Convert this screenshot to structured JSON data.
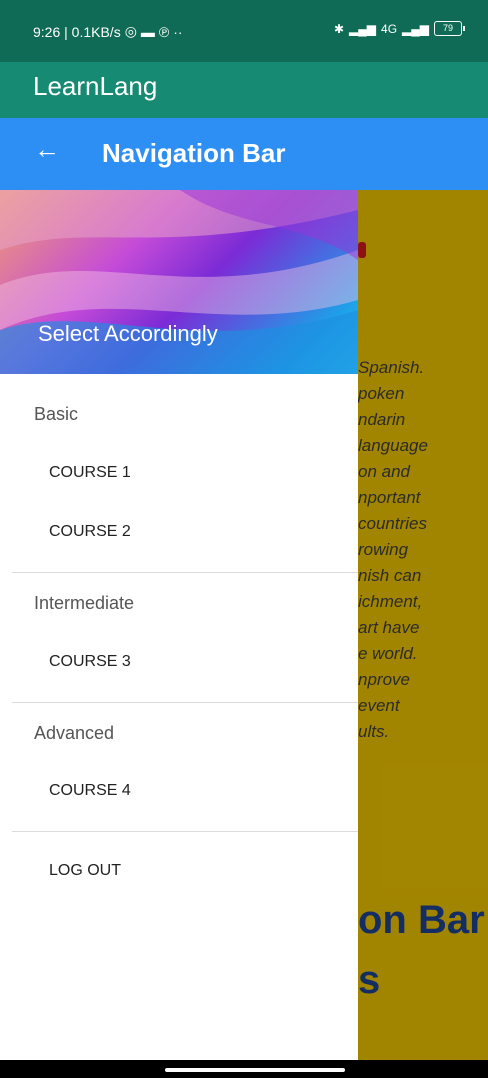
{
  "status_bar": {
    "time_speed": "9:26 | 0.1KB/s",
    "dots": "··",
    "network": "4G",
    "battery": "79"
  },
  "app_bar": {
    "title": "LearnLang"
  },
  "nav_bar": {
    "back_symbol": "←",
    "title": "Navigation Bar"
  },
  "drawer": {
    "header_text": "Select Accordingly",
    "sections": [
      {
        "label": "Basic",
        "items": [
          "COURSE 1",
          "COURSE 2"
        ]
      },
      {
        "label": "Intermediate",
        "items": [
          "COURSE 3"
        ]
      },
      {
        "label": "Advanced",
        "items": [
          "COURSE 4"
        ]
      }
    ],
    "logout_label": "LOG OUT"
  },
  "background": {
    "text_lines": [
      "Spanish.",
      "poken",
      "ndarin",
      "language",
      "on and",
      "nportant",
      "countries",
      "rowing",
      "nish can",
      "ichment,",
      "art have",
      "e world.",
      "nprove",
      "event",
      "ults."
    ],
    "heading_lines": [
      "on Bar",
      "s"
    ]
  },
  "colors": {
    "status_bar": "#0f6b56",
    "app_bar": "#168a73",
    "nav_bar": "#2d8ef3",
    "background_content": "#e0b800"
  },
  "icons": {
    "status": [
      "whatsapp-icon",
      "message-icon",
      "pinterest-icon",
      "bluetooth-icon",
      "signal-icon",
      "battery-icon"
    ],
    "back": "arrow-left-icon"
  }
}
